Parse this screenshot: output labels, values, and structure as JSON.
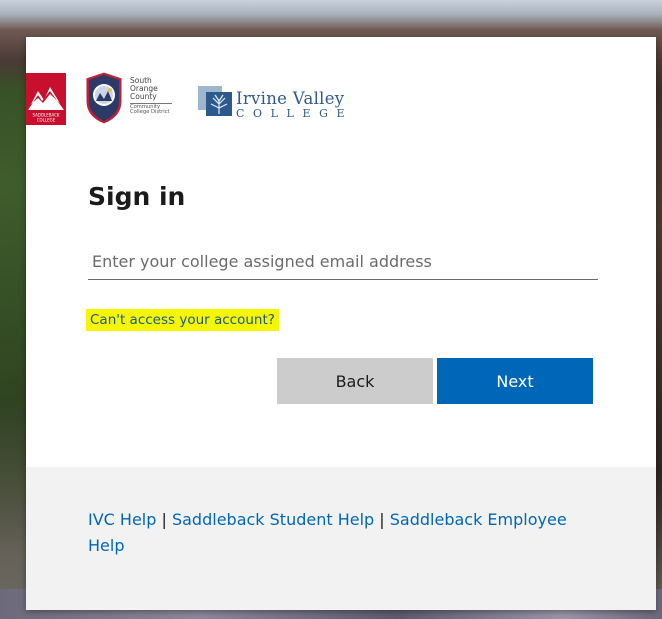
{
  "branding": {
    "saddleback_label": "SADDLEBACK COLLEGE",
    "socccd_lines": [
      "South",
      "Orange",
      "County"
    ],
    "socccd_small": [
      "Community",
      "College District"
    ],
    "ivc_word1": "Irvine Valley",
    "ivc_word2": "COLLEGE",
    "colors": {
      "saddleback_red": "#c8102e",
      "ivc_blue": "#2d5a8c",
      "socccd_red": "#b8233a",
      "socccd_blue": "#2b3a66"
    }
  },
  "signin": {
    "title": "Sign in",
    "email_placeholder": "Enter your college assigned email address",
    "email_value": "",
    "cant_access": "Can't access your account?",
    "back_label": "Back",
    "next_label": "Next",
    "highlight_color": "#f6f600",
    "primary_color": "#0067b8"
  },
  "footer": {
    "links": [
      "IVC Help",
      "Saddleback Student Help",
      "Saddleback Employee Help"
    ],
    "separator": " | "
  }
}
